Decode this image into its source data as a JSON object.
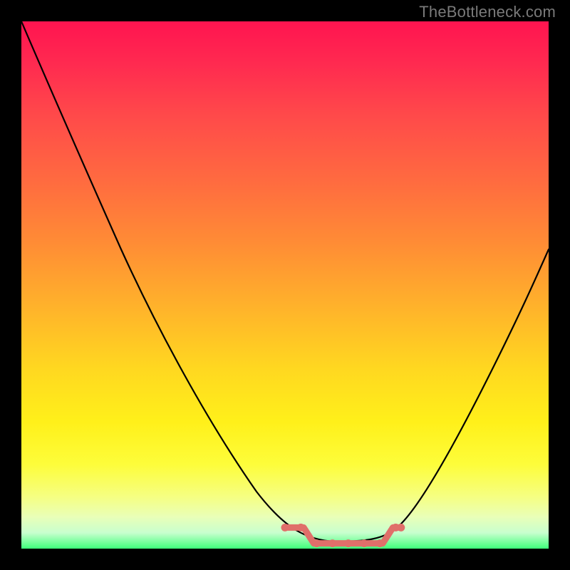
{
  "chart_data": {
    "type": "line",
    "watermark": "TheBottleneck.com",
    "title": "",
    "xlabel": "",
    "ylabel": "",
    "xlim": [
      0,
      100
    ],
    "ylim": [
      0,
      100
    ],
    "grid": false,
    "legend": false,
    "series": [
      {
        "name": "bottleneck_curve",
        "color": "#000000",
        "x": [
          0,
          10,
          20,
          30,
          40,
          50,
          55,
          60,
          65,
          70,
          75,
          80,
          90,
          100
        ],
        "y": [
          100,
          80,
          57,
          40,
          24,
          10,
          4,
          1,
          1,
          1,
          6,
          16,
          38,
          57
        ]
      }
    ],
    "flat_zone": {
      "description": "near-zero bottleneck region highlighted with salmon markers",
      "color": "#e06f6a",
      "x_range": [
        50,
        72
      ],
      "points_x": [
        50,
        53,
        56,
        59,
        62,
        65,
        68,
        71,
        72
      ]
    },
    "gradient_stops": [
      {
        "pos": 0.0,
        "color": "#ff1450"
      },
      {
        "pos": 0.08,
        "color": "#ff2a50"
      },
      {
        "pos": 0.18,
        "color": "#ff4a4a"
      },
      {
        "pos": 0.3,
        "color": "#ff6a40"
      },
      {
        "pos": 0.42,
        "color": "#ff8c35"
      },
      {
        "pos": 0.55,
        "color": "#ffb52a"
      },
      {
        "pos": 0.66,
        "color": "#ffd820"
      },
      {
        "pos": 0.76,
        "color": "#fff01a"
      },
      {
        "pos": 0.84,
        "color": "#fdfd3a"
      },
      {
        "pos": 0.9,
        "color": "#f6ff80"
      },
      {
        "pos": 0.94,
        "color": "#e9ffb8"
      },
      {
        "pos": 0.97,
        "color": "#c8ffce"
      },
      {
        "pos": 1.0,
        "color": "#3fff7a"
      }
    ]
  }
}
